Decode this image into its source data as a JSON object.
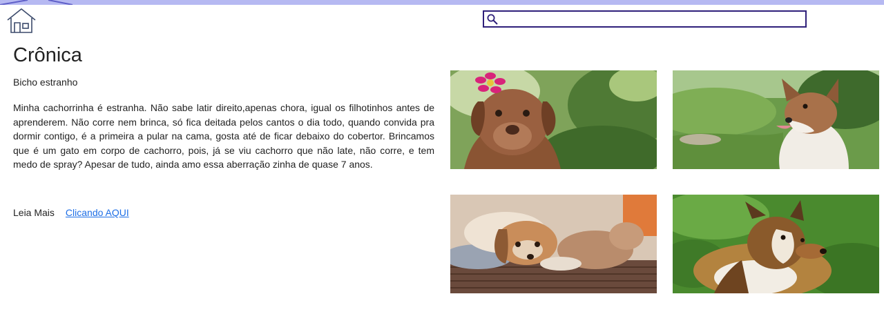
{
  "header": {
    "home_icon": "home-icon",
    "search_icon": "search-icon",
    "search_value": "",
    "search_placeholder": ""
  },
  "article": {
    "title": "Crônica",
    "subtitle": "Bicho estranho",
    "body": "Minha cachorrinha é estranha. Não sabe latir direito,apenas chora, igual os filhotinhos antes de aprenderem. Não corre nem brinca, só fica deitada pelos cantos o dia todo, quando convida pra dormir contigo, é a primeira a pular na cama, gosta até de ficar debaixo do cobertor. Brincamos que é um gato em corpo de cachorro, pois, já se viu cachorro que não late, não corre, e tem medo de spray? Apesar de tudo, ainda amo essa aberração zinha de quase 7 anos.",
    "read_more_label": "Leia Mais",
    "read_more_link": "Clicando AQUI"
  },
  "gallery": [
    "puppy-with-pink-flower",
    "dog-in-green-field",
    "dog-lying-with-plush-toy",
    "sheltie-dog-on-grass"
  ],
  "colors": {
    "top_bar": "#b6b9f2",
    "search_border": "#2e1f7a",
    "link": "#1d6ee6",
    "home_icon": "#3b4a6b"
  }
}
